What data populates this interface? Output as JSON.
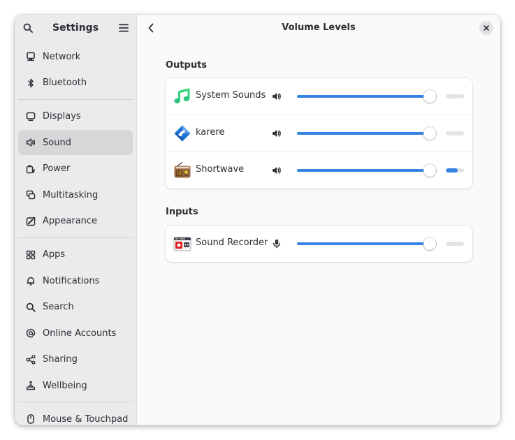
{
  "sidebar": {
    "title": "Settings",
    "search_icon": "search-icon",
    "menu_icon": "hamburger-menu-icon",
    "groups": [
      [
        {
          "label": "Network",
          "icon": "network-icon"
        },
        {
          "label": "Bluetooth",
          "icon": "bluetooth-icon"
        }
      ],
      [
        {
          "label": "Displays",
          "icon": "display-icon"
        },
        {
          "label": "Sound",
          "icon": "speaker-icon",
          "active": true
        },
        {
          "label": "Power",
          "icon": "power-plug-icon"
        },
        {
          "label": "Multitasking",
          "icon": "multitasking-icon"
        },
        {
          "label": "Appearance",
          "icon": "appearance-icon"
        }
      ],
      [
        {
          "label": "Apps",
          "icon": "apps-grid-icon"
        },
        {
          "label": "Notifications",
          "icon": "bell-icon"
        },
        {
          "label": "Search",
          "icon": "search-icon"
        },
        {
          "label": "Online Accounts",
          "icon": "at-sign-icon"
        },
        {
          "label": "Sharing",
          "icon": "share-icon"
        },
        {
          "label": "Wellbeing",
          "icon": "wellbeing-icon"
        }
      ],
      [
        {
          "label": "Mouse & Touchpad",
          "icon": "mouse-icon"
        }
      ]
    ]
  },
  "main": {
    "title": "Volume Levels",
    "back_icon": "back-chevron-icon",
    "close_icon": "close-icon",
    "sections": [
      {
        "title": "Outputs",
        "rows": [
          {
            "name": "System Sounds",
            "app_icon": "music-note-app-icon",
            "control_icon": "speaker-volume-icon",
            "volume": 0.95,
            "level": 0.0
          },
          {
            "name": "karere",
            "app_icon": "karere-app-icon",
            "control_icon": "speaker-volume-icon",
            "volume": 0.95,
            "level": 0.0
          },
          {
            "name": "Shortwave",
            "app_icon": "radio-app-icon",
            "control_icon": "speaker-volume-icon",
            "volume": 0.95,
            "level": 0.65
          }
        ]
      },
      {
        "title": "Inputs",
        "rows": [
          {
            "name": "Sound Recorder",
            "app_icon": "sound-recorder-app-icon",
            "control_icon": "microphone-icon",
            "volume": 0.95,
            "level": 0.0
          }
        ]
      }
    ]
  },
  "colors": {
    "accent": "#3584e4",
    "sidebar_bg": "#ebebed",
    "active_item_bg": "#d7d7da",
    "text": "#2e2e33"
  }
}
